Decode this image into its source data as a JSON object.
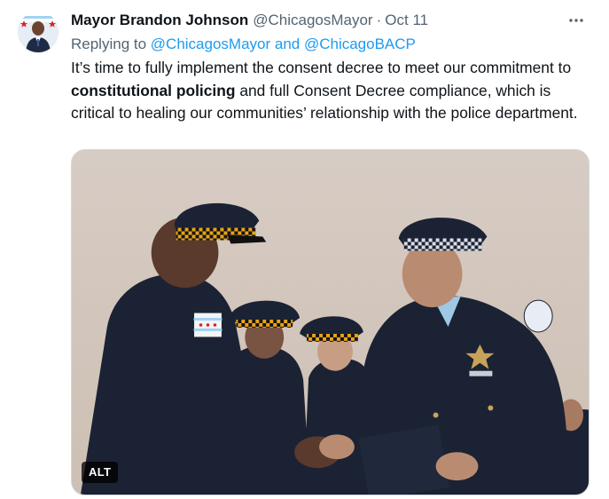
{
  "tweet": {
    "author_name": "Mayor Brandon Johnson",
    "author_handle": "@ChicagosMayor",
    "separator": "·",
    "date": "Oct 11",
    "more_icon": "more-horizontal-icon",
    "replying_prefix": "Replying to ",
    "replying_to": "@ChicagosMayor and @ChicagoBACP",
    "text_part1": "It’s time to fully implement the consent decree to meet our commitment to ",
    "text_bold": "constitutional policing",
    "text_part2": " and full Consent Decree compliance, which is critical to healing our communities’ relationship with the police department.",
    "media_alt_label": "ALT"
  },
  "colors": {
    "accent": "#1d9bf0",
    "secondary_text": "#536471",
    "primary_text": "#0f1419",
    "uniform_navy": "#1b2233",
    "hat_check": "#e8a317"
  }
}
